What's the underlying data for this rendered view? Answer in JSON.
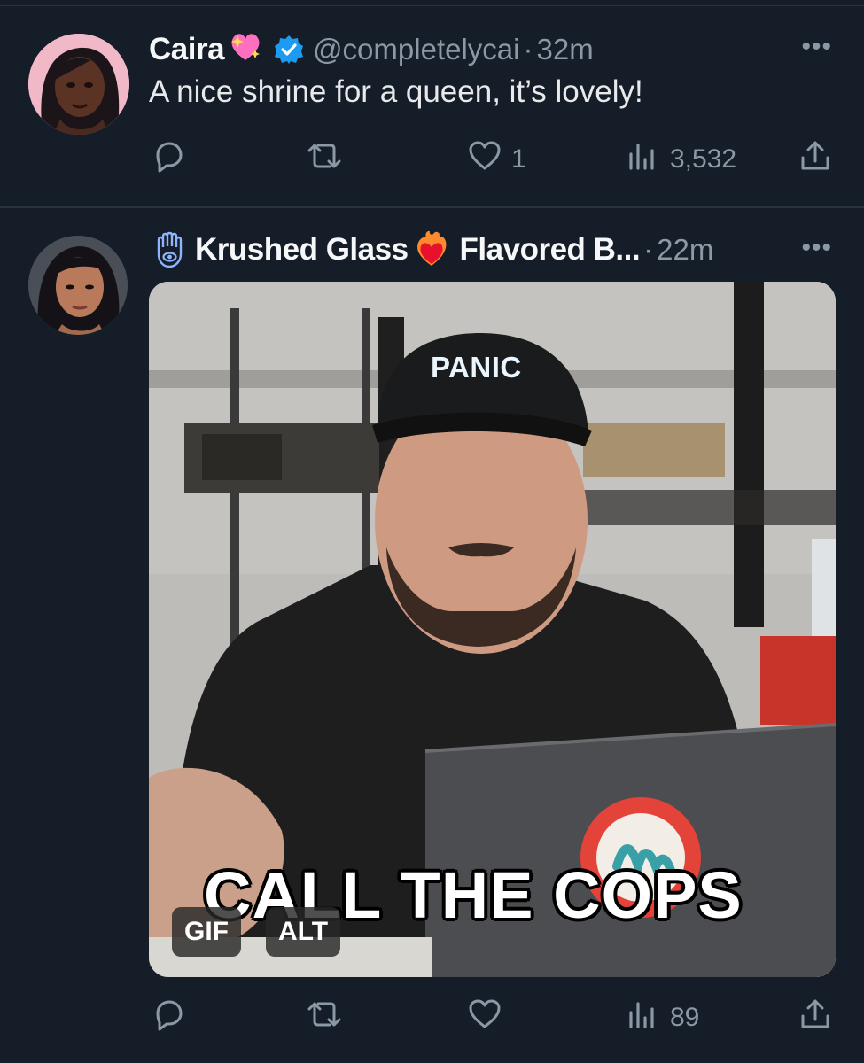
{
  "tweets": [
    {
      "display_name": "Caira",
      "name_emoji": "💖",
      "verified": true,
      "handle": "@completelycai",
      "separator": "·",
      "time": "32m",
      "more_label": "•••",
      "text": "A nice shrine for a queen, it’s lovely!",
      "actions": {
        "reply_count": "",
        "repost_count": "",
        "like_count": "1",
        "views_count": "3,532"
      }
    },
    {
      "display_name": "Krushed Glass",
      "name_prefix_icon": "hamsa-eye-icon",
      "name_emoji": "❤️‍🔥",
      "display_name_suffix": "Flavored B...",
      "separator": "·",
      "time": "22m",
      "more_label": "•••",
      "media": {
        "caption": "CALL THE COPS",
        "hat_text": "PANIC",
        "badges": {
          "gif": "GIF",
          "alt": "ALT"
        }
      },
      "actions": {
        "reply_count": "",
        "repost_count": "",
        "like_count": "",
        "views_count": "89"
      }
    }
  ],
  "colors": {
    "background": "#151d28",
    "muted": "#8b98a5",
    "verified": "#1d9bf0",
    "text": "#e7e9ea"
  }
}
